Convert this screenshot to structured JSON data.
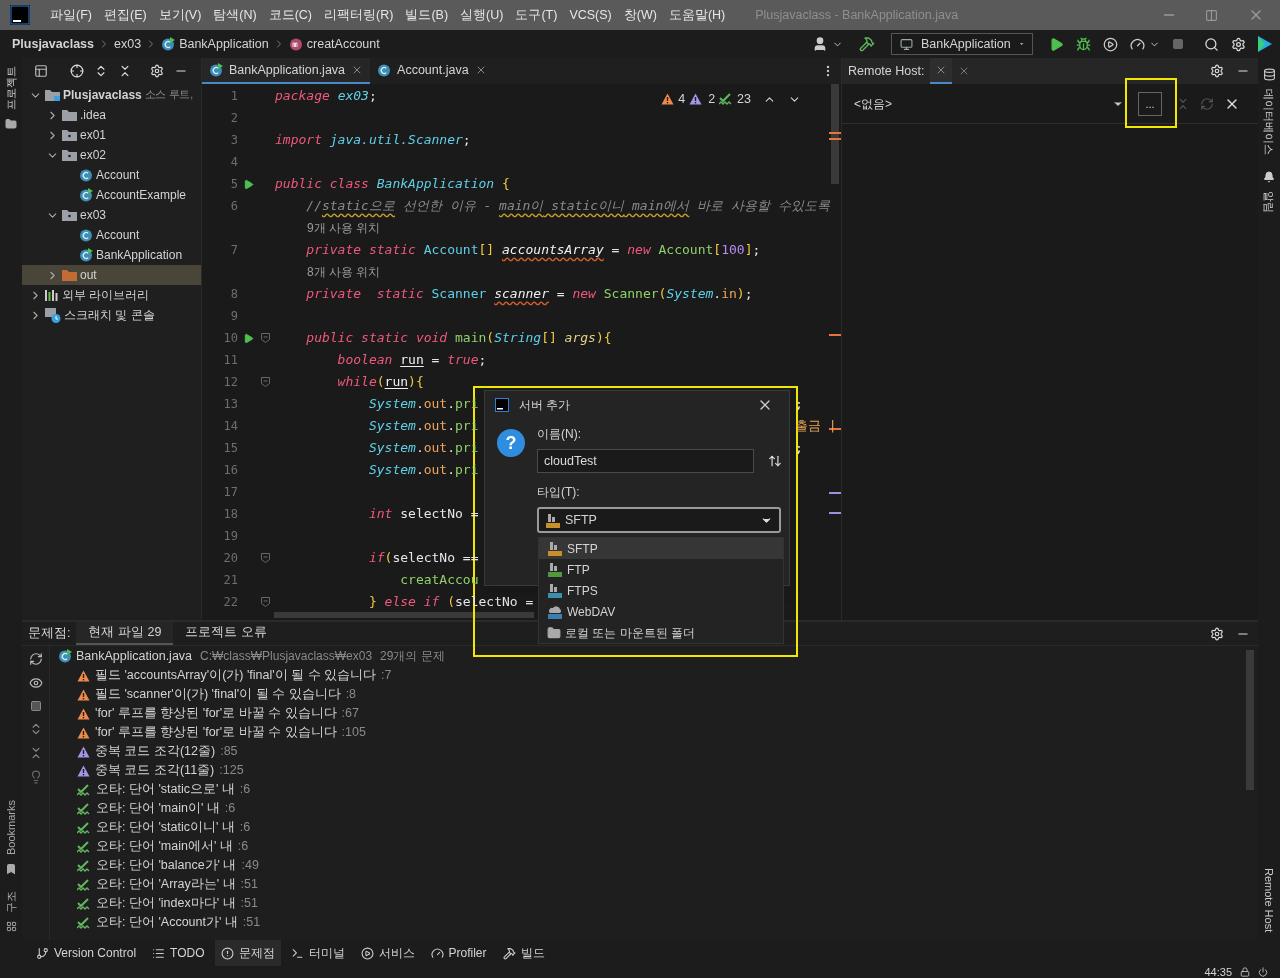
{
  "window": {
    "title": "Plusjavaclass - BankApplication.java"
  },
  "menu": [
    "파일(F)",
    "편집(E)",
    "보기(V)",
    "탐색(N)",
    "코드(C)",
    "리팩터링(R)",
    "빌드(B)",
    "실행(U)",
    "도구(T)",
    "VCS(S)",
    "창(W)",
    "도움말(H)"
  ],
  "breadcrumbs": [
    {
      "label": "Plusjavaclass",
      "kind": "project"
    },
    {
      "label": "ex03",
      "kind": "package"
    },
    {
      "label": "BankApplication",
      "kind": "class"
    },
    {
      "label": "creatAccount",
      "kind": "method"
    }
  ],
  "run_config": "BankApplication",
  "left_stripe": {
    "top": "프로젝트",
    "bookmarks": "Bookmarks",
    "structure": "구조"
  },
  "right_stripe": {
    "database": "데이터베이스",
    "notifications": "알림",
    "remote": "Remote Host"
  },
  "project_tree": [
    {
      "label": "Plusjavaclass",
      "note": "소스 루트,",
      "kind": "module",
      "expanded": true,
      "selected": false,
      "children": [
        {
          "label": ".idea",
          "kind": "folder",
          "expanded": false,
          "selected": false
        },
        {
          "label": "ex01",
          "kind": "package",
          "expanded": false,
          "selected": false
        },
        {
          "label": "ex02",
          "kind": "package",
          "expanded": true,
          "selected": false,
          "children": [
            {
              "label": "Account",
              "kind": "class",
              "selected": false
            },
            {
              "label": "AccountExample",
              "kind": "runclass",
              "selected": false
            }
          ]
        },
        {
          "label": "ex03",
          "kind": "package",
          "expanded": true,
          "selected": false,
          "children": [
            {
              "label": "Account",
              "kind": "class",
              "selected": false
            },
            {
              "label": "BankApplication",
              "kind": "runclass",
              "selected": false
            }
          ]
        },
        {
          "label": "out",
          "kind": "outfolder",
          "expanded": false,
          "selected": true
        }
      ]
    },
    {
      "label": "외부 라이브러리",
      "kind": "library",
      "expanded": false,
      "selected": false
    },
    {
      "label": "스크래치 및 콘솔",
      "kind": "scratch",
      "expanded": false,
      "selected": false
    }
  ],
  "editor_tabs": [
    {
      "label": "BankApplication.java",
      "kind": "runclass",
      "selected": true
    },
    {
      "label": "Account.java",
      "kind": "class",
      "selected": false
    }
  ],
  "inspections": {
    "warnings": "4",
    "weak": "2",
    "typos": "23"
  },
  "code": [
    {
      "n": "1",
      "tokens": [
        {
          "kind": "keyword",
          "text": "package "
        },
        {
          "kind": "package",
          "text": "ex03"
        },
        {
          "kind": "plain",
          "text": ";"
        }
      ]
    },
    {
      "n": "2"
    },
    {
      "n": "3",
      "tokens": [
        {
          "kind": "keyword",
          "text": "import "
        },
        {
          "kind": "package",
          "text": "java.util.Scanner"
        },
        {
          "kind": "plain",
          "text": ";"
        }
      ]
    },
    {
      "n": "4"
    },
    {
      "n": "5",
      "run": true,
      "tokens": [
        {
          "kind": "keyword",
          "text": "public class "
        },
        {
          "kind": "package",
          "text": "BankApplication "
        },
        {
          "kind": "bracket",
          "text": "{"
        }
      ]
    },
    {
      "n": "6",
      "tokens": [
        {
          "kind": "comment",
          "text": "    //"
        },
        {
          "kind": "typo",
          "text": "static으로"
        },
        {
          "kind": "comment",
          "text": " 선언한 이유 - "
        },
        {
          "kind": "typo",
          "text": "main이"
        },
        {
          "kind": "typo",
          "text": " static이니"
        },
        {
          "kind": "typo",
          "text": " main에서"
        },
        {
          "kind": "comment",
          "text": " 바로 사용할 수있도록"
        }
      ]
    },
    {
      "hint": "9개 사용 위치"
    },
    {
      "n": "7",
      "tokens": [
        {
          "kind": "keyword",
          "text": "    private static "
        },
        {
          "kind": "type",
          "text": "Account"
        },
        {
          "kind": "bracket",
          "text": "[] "
        },
        {
          "kind": "warn_var",
          "text": "accountsArray"
        },
        {
          "kind": "plain",
          "text": " = "
        },
        {
          "kind": "keyword",
          "text": "new "
        },
        {
          "kind": "call",
          "text": "Account"
        },
        {
          "kind": "bracket",
          "text": "["
        },
        {
          "kind": "number",
          "text": "100"
        },
        {
          "kind": "bracket",
          "text": "]"
        },
        {
          "kind": "plain",
          "text": ";"
        }
      ]
    },
    {
      "hint": "8개 사용 위치"
    },
    {
      "n": "8",
      "tokens": [
        {
          "kind": "keyword",
          "text": "    private  static "
        },
        {
          "kind": "type",
          "text": "Scanner "
        },
        {
          "kind": "warn_var",
          "text": "scanner"
        },
        {
          "kind": "plain",
          "text": " = "
        },
        {
          "kind": "keyword",
          "text": "new "
        },
        {
          "kind": "call",
          "text": "Scanner"
        },
        {
          "kind": "bracket",
          "text": "("
        },
        {
          "kind": "package",
          "text": "System"
        },
        {
          "kind": "plain",
          "text": "."
        },
        {
          "kind": "field",
          "text": "in"
        },
        {
          "kind": "bracket",
          "text": ")"
        },
        {
          "kind": "plain",
          "text": ";"
        }
      ]
    },
    {
      "n": "9"
    },
    {
      "n": "10",
      "run": true,
      "fold": true,
      "tokens": [
        {
          "kind": "keyword",
          "text": "    public static void "
        },
        {
          "kind": "call",
          "text": "main"
        },
        {
          "kind": "bracket",
          "text": "("
        },
        {
          "kind": "package",
          "text": "String"
        },
        {
          "kind": "bracket",
          "text": "[] "
        },
        {
          "kind": "param",
          "text": "args"
        },
        {
          "kind": "bracket",
          "text": "){"
        }
      ]
    },
    {
      "n": "11",
      "tokens": [
        {
          "kind": "keyword",
          "text": "        boolean "
        },
        {
          "kind": "used_var",
          "text": "run"
        },
        {
          "kind": "plain",
          "text": " = "
        },
        {
          "kind": "keyword",
          "text": "true"
        },
        {
          "kind": "plain",
          "text": ";"
        }
      ]
    },
    {
      "n": "12",
      "fold": true,
      "tokens": [
        {
          "kind": "keyword",
          "text": "        while"
        },
        {
          "kind": "bracket",
          "text": "("
        },
        {
          "kind": "used_var",
          "text": "run"
        },
        {
          "kind": "bracket",
          "text": "){"
        }
      ]
    },
    {
      "n": "13",
      "tokens": [
        {
          "kind": "package",
          "text": "            System"
        },
        {
          "kind": "plain",
          "text": "."
        },
        {
          "kind": "field",
          "text": "out"
        },
        {
          "kind": "plain",
          "text": "."
        },
        {
          "kind": "call",
          "text": "pri"
        }
      ],
      "tail": {
        "kind": "plain",
        "text": ";"
      }
    },
    {
      "n": "14",
      "tokens": [
        {
          "kind": "package",
          "text": "            System"
        },
        {
          "kind": "plain",
          "text": "."
        },
        {
          "kind": "field",
          "text": "out"
        },
        {
          "kind": "plain",
          "text": "."
        },
        {
          "kind": "call",
          "text": "pri"
        }
      ],
      "tail": {
        "kind": "string",
        "text": "출금 |"
      }
    },
    {
      "n": "15",
      "tokens": [
        {
          "kind": "package",
          "text": "            System"
        },
        {
          "kind": "plain",
          "text": "."
        },
        {
          "kind": "field",
          "text": "out"
        },
        {
          "kind": "plain",
          "text": "."
        },
        {
          "kind": "call",
          "text": "pri"
        }
      ],
      "tail": {
        "kind": "plain",
        "text": ";"
      }
    },
    {
      "n": "16",
      "tokens": [
        {
          "kind": "package",
          "text": "            System"
        },
        {
          "kind": "plain",
          "text": "."
        },
        {
          "kind": "field",
          "text": "out"
        },
        {
          "kind": "plain",
          "text": "."
        },
        {
          "kind": "call",
          "text": "pri"
        }
      ]
    },
    {
      "n": "17"
    },
    {
      "n": "18",
      "tokens": [
        {
          "kind": "keyword",
          "text": "            int"
        },
        {
          "kind": "plain",
          "text": " selectNo ="
        }
      ]
    },
    {
      "n": "19"
    },
    {
      "n": "20",
      "fold": true,
      "tokens": [
        {
          "kind": "keyword",
          "text": "            if"
        },
        {
          "kind": "bracket",
          "text": "("
        },
        {
          "kind": "plain",
          "text": "selectNo =="
        }
      ]
    },
    {
      "n": "21",
      "tokens": [
        {
          "kind": "call",
          "text": "                creatAccou"
        }
      ]
    },
    {
      "n": "22",
      "fold": true,
      "tokens": [
        {
          "kind": "bracket",
          "text": "            }"
        },
        {
          "kind": "keyword",
          "text": " else if "
        },
        {
          "kind": "bracket",
          "text": "("
        },
        {
          "kind": "plain",
          "text": "selectNo ="
        }
      ]
    }
  ],
  "remote_host": {
    "label": "Remote Host:",
    "server": "<없음>",
    "browse": "..."
  },
  "dialog": {
    "title": "서버 추가",
    "icon": "?",
    "name_label": "이름(N):",
    "name_value": "cloudTest",
    "type_label": "타입(T):",
    "type_selected": {
      "kind": "sftp",
      "label": "SFTP"
    },
    "options": [
      {
        "label": "SFTP",
        "kind": "sftp",
        "selected": true
      },
      {
        "label": "FTP",
        "kind": "ftp",
        "selected": false
      },
      {
        "label": "FTPS",
        "kind": "ftps",
        "selected": false
      },
      {
        "label": "WebDAV",
        "kind": "webdav",
        "selected": false
      },
      {
        "label": "로컬 또는 마운트된 폴더",
        "kind": "folder",
        "selected": false
      }
    ]
  },
  "problems": {
    "title": "문제점:",
    "tabs": [
      {
        "label": "현재 파일 29",
        "selected": true
      },
      {
        "label": "프로젝트 오류",
        "selected": false
      }
    ],
    "file": "BankApplication.java",
    "path": "C:₩class₩Plusjavaclass₩ex03",
    "count": "29개의 문제",
    "items": [
      {
        "kind": "warning",
        "text": "필드 'accountsArray'이(가) 'final'이 될 수 있습니다",
        "line": ":7"
      },
      {
        "kind": "warning",
        "text": "필드 'scanner'이(가) 'final'이 될 수 있습니다",
        "line": ":8"
      },
      {
        "kind": "warning",
        "text": "'for' 루프를 향상된 'for'로 바꿀 수 있습니다",
        "line": ":67"
      },
      {
        "kind": "warning",
        "text": "'for' 루프를 향상된 'for'로 바꿀 수 있습니다",
        "line": ":105"
      },
      {
        "kind": "weak",
        "text": "중복 코드 조각(12줄)",
        "line": ":85"
      },
      {
        "kind": "weak",
        "text": "중복 코드 조각(11줄)",
        "line": ":125"
      },
      {
        "kind": "typo",
        "text": "오타: 단어 'static으로' 내",
        "line": ":6"
      },
      {
        "kind": "typo",
        "text": "오타: 단어 'main이' 내",
        "line": ":6"
      },
      {
        "kind": "typo",
        "text": "오타: 단어 'static이니' 내",
        "line": ":6"
      },
      {
        "kind": "typo",
        "text": "오타: 단어 'main에서' 내",
        "line": ":6"
      },
      {
        "kind": "typo",
        "text": "오타: 단어 'balance가' 내",
        "line": ":49"
      },
      {
        "kind": "typo",
        "text": "오타: 단어 'Array라는' 내",
        "line": ":51"
      },
      {
        "kind": "typo",
        "text": "오타: 단어 'index마다' 내",
        "line": ":51"
      },
      {
        "kind": "typo",
        "text": "오타: 단어 'Account가' 내",
        "line": ":51"
      }
    ]
  },
  "tool_tabs": [
    {
      "label": "Version Control",
      "kind": "vcs",
      "selected": false
    },
    {
      "label": "TODO",
      "kind": "todo",
      "selected": false
    },
    {
      "label": "문제점",
      "kind": "problems",
      "selected": true
    },
    {
      "label": "터미널",
      "kind": "terminal",
      "selected": false
    },
    {
      "label": "서비스",
      "kind": "services",
      "selected": false
    },
    {
      "label": "Profiler",
      "kind": "profiler",
      "selected": false
    },
    {
      "label": "빌드",
      "kind": "build",
      "selected": false
    }
  ],
  "status_bar": {
    "position": "44:35"
  }
}
